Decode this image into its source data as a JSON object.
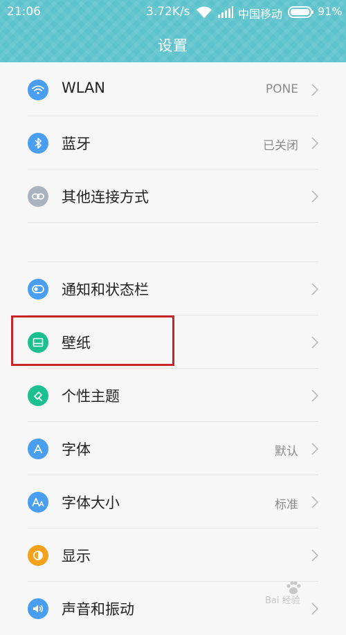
{
  "status_bar": {
    "time": "21:06",
    "speed": "3.72K/s",
    "carrier": "中国移动",
    "battery": "91%"
  },
  "header": {
    "title": "设置"
  },
  "colors": {
    "header": "#5cc2cc",
    "icon_blue": "#4a9ef0",
    "icon_gray": "#a9b2bd",
    "icon_green": "#1cbf8f",
    "icon_orange": "#f4a21b",
    "highlight": "#c8252b"
  },
  "settings": {
    "wlan": {
      "label": "WLAN",
      "value": "PONE",
      "icon": "wifi-icon"
    },
    "bluetooth": {
      "label": "蓝牙",
      "value": "已关闭",
      "icon": "bluetooth-icon"
    },
    "other_connections": {
      "label": "其他连接方式",
      "icon": "link-icon"
    },
    "notifications": {
      "label": "通知和状态栏",
      "icon": "toggle-icon"
    },
    "wallpaper": {
      "label": "壁纸",
      "icon": "image-icon"
    },
    "themes": {
      "label": "个性主题",
      "icon": "brush-icon"
    },
    "font": {
      "label": "字体",
      "value": "默认",
      "icon": "letter-a-icon"
    },
    "font_size": {
      "label": "字体大小",
      "value": "标准",
      "icon": "font-size-icon"
    },
    "display": {
      "label": "显示",
      "icon": "half-circle-icon"
    },
    "sound": {
      "label": "声音和振动",
      "icon": "speaker-icon"
    }
  },
  "watermark": {
    "text": "Bai 经验"
  }
}
